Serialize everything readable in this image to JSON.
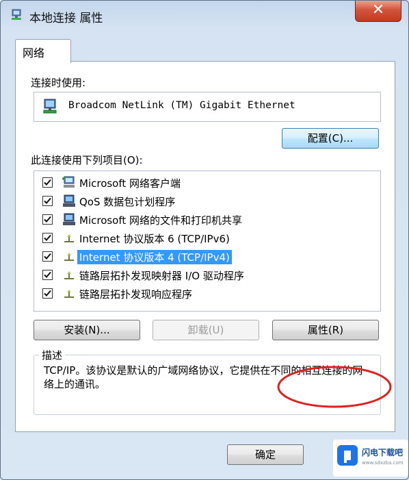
{
  "window": {
    "title": "本地连接 属性",
    "close_label": "✕"
  },
  "tabs": [
    {
      "label": "网络"
    }
  ],
  "connect_using": {
    "label": "连接时使用:",
    "adapter": "Broadcom NetLink (TM) Gigabit Ethernet",
    "configure_label": "配置(C)..."
  },
  "items": {
    "label": "此连接使用下列项目(O):",
    "list": [
      {
        "label": "Microsoft 网络客户端",
        "checked": true,
        "icon": "network-client-icon"
      },
      {
        "label": "QoS 数据包计划程序",
        "checked": true,
        "icon": "qos-scheduler-icon"
      },
      {
        "label": "Microsoft 网络的文件和打印机共享",
        "checked": true,
        "icon": "file-printer-sharing-icon"
      },
      {
        "label": "Internet 协议版本 6 (TCP/IPv6)",
        "checked": true,
        "icon": "protocol-icon"
      },
      {
        "label": "Internet 协议版本 4 (TCP/IPv4)",
        "checked": true,
        "icon": "protocol-icon",
        "selected": true
      },
      {
        "label": "链路层拓扑发现映射器 I/O 驱动程序",
        "checked": true,
        "icon": "protocol-icon"
      },
      {
        "label": "链路层拓扑发现响应程序",
        "checked": true,
        "icon": "protocol-icon"
      }
    ]
  },
  "buttons": {
    "install": "安装(N)...",
    "uninstall": "卸载(U)",
    "properties": "属性(R)",
    "ok": "确定"
  },
  "description": {
    "title": "描述",
    "text": "TCP/IP。该协议是默认的广域网络协议，它提供在不同的相互连接的网络上的通讯。"
  },
  "watermark": {
    "text": "闪电下载吧",
    "sub": "www.sdxzba.com"
  },
  "colors": {
    "selection": "#3399ff",
    "annotation": "#e02020",
    "close_button": "#c94a33"
  }
}
